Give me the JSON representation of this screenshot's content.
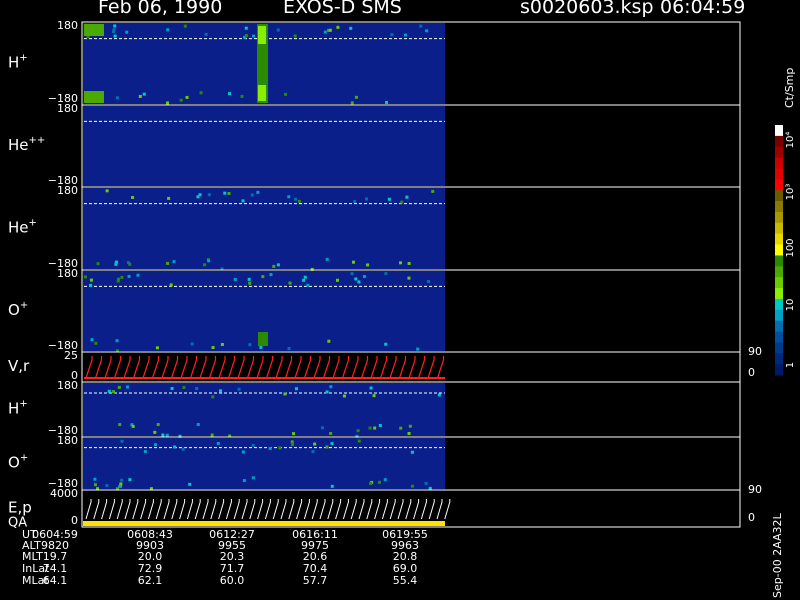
{
  "header": {
    "date": "Feb 06, 1990",
    "mission": "EXOS-D SMS",
    "file": "s0020603.ksp",
    "time": "06:04:59"
  },
  "panels": [
    {
      "label": "H",
      "sup": "+",
      "ymax": "180",
      "ymin": "-180"
    },
    {
      "label": "He",
      "sup": "++",
      "ymax": "180",
      "ymin": "-180"
    },
    {
      "label": "He",
      "sup": "+",
      "ymax": "180",
      "ymin": "-180"
    },
    {
      "label": "O",
      "sup": "+",
      "ymax": "180",
      "ymin": "-180"
    },
    {
      "label": "V,r",
      "sup": "",
      "ymax": "25",
      "ymin": "0",
      "rmax": "90",
      "rmin": "0"
    },
    {
      "label": "H",
      "sup": "+",
      "ymax": "180",
      "ymin": "-180"
    },
    {
      "label": "O",
      "sup": "+",
      "ymax": "180",
      "ymin": "-180"
    },
    {
      "label": "E,p",
      "sup": "",
      "label2": "QA",
      "ymax": "4000",
      "ymin": "0",
      "rmax": "90",
      "rmin": "0"
    }
  ],
  "colorbar": {
    "unit": "Ct/Smp",
    "ticks": [
      "10⁴",
      "10³",
      "100",
      "10",
      "1"
    ],
    "colors": [
      "#ffffff",
      "#7a0000",
      "#a00000",
      "#c80000",
      "#e00000",
      "#ff0000",
      "#6b5a00",
      "#8a7a00",
      "#a89800",
      "#c8b800",
      "#e8d800",
      "#ffff00",
      "#2a8a00",
      "#4aaa00",
      "#6acc00",
      "#8aee00",
      "#00c8c8",
      "#00a0c8",
      "#0070b0",
      "#0050a0",
      "#003a8a",
      "#00287a",
      "#001a6a"
    ]
  },
  "colors": {
    "spectrogram_bg": "#0a1f8a",
    "dashed_line": "#ffffff",
    "vr_trace": "#ff2020",
    "qa_bar": "#ffe000"
  },
  "ephemeris": {
    "labels": [
      "UT",
      "ALT",
      "MLT",
      "InLat",
      "MLat"
    ],
    "columns": [
      {
        "UT": "0604:59",
        "ALT": "9820",
        "MLT": "19.7",
        "InLat": "74.1",
        "MLat": "64.1"
      },
      {
        "UT": "0608:43",
        "ALT": "9903",
        "MLT": "20.0",
        "InLat": "72.9",
        "MLat": "62.1"
      },
      {
        "UT": "0612:27",
        "ALT": "9955",
        "MLT": "20.3",
        "InLat": "71.7",
        "MLat": "60.0"
      },
      {
        "UT": "0616:11",
        "ALT": "9975",
        "MLT": "20.6",
        "InLat": "70.4",
        "MLat": "57.7"
      },
      {
        "UT": "0619:55",
        "ALT": "9963",
        "MLT": "20.8",
        "InLat": "69.0",
        "MLat": "55.4"
      }
    ]
  },
  "footer_note": "Sep-00 2AA32L",
  "chart_data": {
    "type": "heatmap",
    "title": "Feb 06, 1990 EXOS-D SMS",
    "xlabel": "UT",
    "x": [
      "0604:59",
      "0608:43",
      "0612:27",
      "0616:11",
      "0619:55"
    ],
    "data_fraction_of_axis": 0.53,
    "series": [
      {
        "name": "H+",
        "ylim": [
          -180,
          180
        ]
      },
      {
        "name": "He++",
        "ylim": [
          -180,
          180
        ]
      },
      {
        "name": "He+",
        "ylim": [
          -180,
          180
        ]
      },
      {
        "name": "O+",
        "ylim": [
          -180,
          180
        ]
      },
      {
        "name": "V,r",
        "ylim": [
          0,
          25
        ],
        "right_ylim": [
          0,
          90
        ]
      },
      {
        "name": "H+",
        "ylim": [
          -180,
          180
        ]
      },
      {
        "name": "O+",
        "ylim": [
          -180,
          180
        ]
      },
      {
        "name": "E,p QA",
        "ylim": [
          0,
          4000
        ],
        "right_ylim": [
          0,
          90
        ]
      }
    ],
    "colorbar_range": [
      1,
      10000
    ],
    "colorbar_scale": "log",
    "colorbar_label": "Ct/Smp"
  }
}
